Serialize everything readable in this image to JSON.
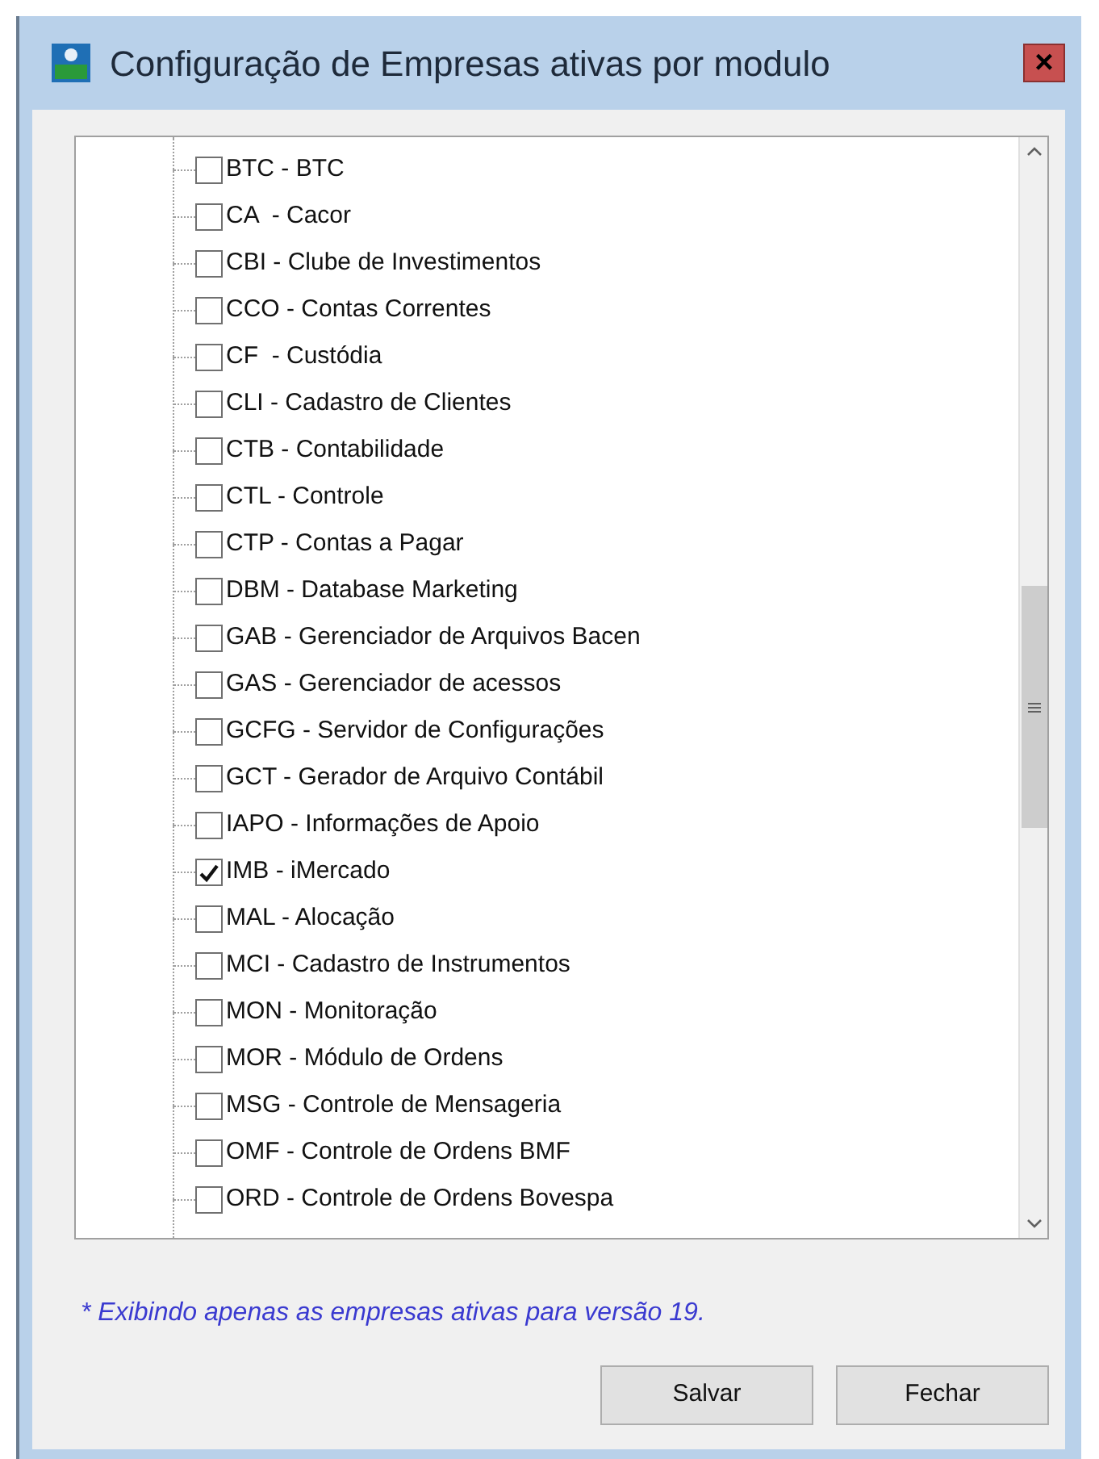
{
  "window": {
    "title": "Configuração de Empresas ativas por modulo",
    "close": "×"
  },
  "modules": [
    {
      "label": "BTC - BTC",
      "checked": false
    },
    {
      "label": "CA  - Cacor",
      "checked": false
    },
    {
      "label": "CBI - Clube de Investimentos",
      "checked": false
    },
    {
      "label": "CCO - Contas Correntes",
      "checked": false
    },
    {
      "label": "CF  - Custódia",
      "checked": false
    },
    {
      "label": "CLI - Cadastro de Clientes",
      "checked": false
    },
    {
      "label": "CTB - Contabilidade",
      "checked": false
    },
    {
      "label": "CTL - Controle",
      "checked": false
    },
    {
      "label": "CTP - Contas a Pagar",
      "checked": false
    },
    {
      "label": "DBM - Database Marketing",
      "checked": false
    },
    {
      "label": "GAB - Gerenciador de Arquivos Bacen",
      "checked": false
    },
    {
      "label": "GAS - Gerenciador de acessos",
      "checked": false
    },
    {
      "label": "GCFG - Servidor de Configurações",
      "checked": false
    },
    {
      "label": "GCT - Gerador de Arquivo Contábil",
      "checked": false
    },
    {
      "label": "IAPO - Informações de Apoio",
      "checked": false
    },
    {
      "label": "IMB - iMercado",
      "checked": true
    },
    {
      "label": "MAL - Alocação",
      "checked": false
    },
    {
      "label": "MCI - Cadastro de Instrumentos",
      "checked": false
    },
    {
      "label": "MON - Monitoração",
      "checked": false
    },
    {
      "label": "MOR - Módulo de Ordens",
      "checked": false
    },
    {
      "label": "MSG - Controle de Mensageria",
      "checked": false
    },
    {
      "label": "OMF - Controle de Ordens BMF",
      "checked": false
    },
    {
      "label": "ORD - Controle de Ordens Bovespa",
      "checked": false
    }
  ],
  "note": "* Exibindo apenas as empresas ativas para versão 19.",
  "buttons": [
    "Salvar",
    "Fechar"
  ]
}
